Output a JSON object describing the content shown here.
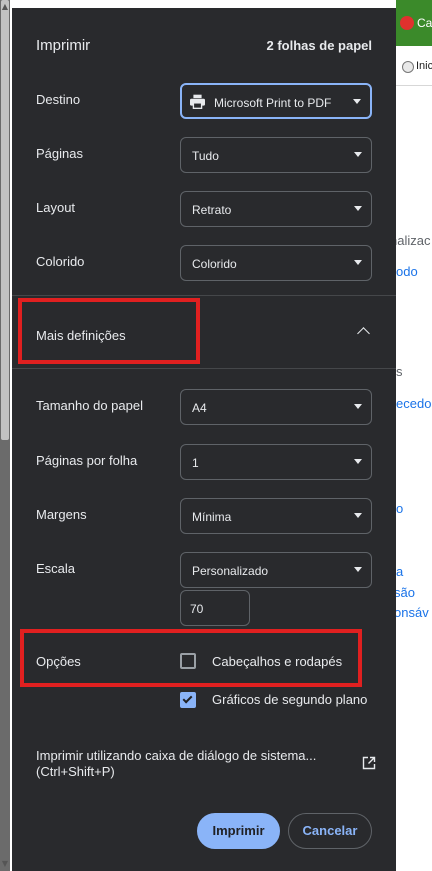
{
  "background": {
    "tab_text": "Ca",
    "toolbar_text": "Inicia",
    "fragments": [
      "nalizac",
      "odo",
      "s",
      "ecedo",
      "o",
      "a",
      "são",
      "onsáv"
    ]
  },
  "dialog": {
    "title": "Imprimir",
    "sheet_count": "2 folhas de papel",
    "destination": {
      "label": "Destino",
      "value": "Microsoft Print to PDF"
    },
    "pages": {
      "label": "Páginas",
      "value": "Tudo"
    },
    "layout": {
      "label": "Layout",
      "value": "Retrato"
    },
    "color": {
      "label": "Colorido",
      "value": "Colorido"
    },
    "more_settings": "Mais definições",
    "paper_size": {
      "label": "Tamanho do papel",
      "value": "A4"
    },
    "pages_per_sheet": {
      "label": "Páginas por folha",
      "value": "1"
    },
    "margins": {
      "label": "Margens",
      "value": "Mínima"
    },
    "scale": {
      "label": "Escala",
      "value": "Personalizado",
      "custom_value": "70"
    },
    "options": {
      "label": "Opções",
      "headers_footers": {
        "label": "Cabeçalhos e rodapés",
        "checked": false
      },
      "background_graphics": {
        "label": "Gráficos de segundo plano",
        "checked": true
      }
    },
    "system_dialog": {
      "line1": "Imprimir utilizando caixa de diálogo de sistema...",
      "line2": "(Ctrl+Shift+P)"
    },
    "print_button": "Imprimir",
    "cancel_button": "Cancelar"
  },
  "colors": {
    "dialog_bg": "#292a2d",
    "accent": "#8ab4f8",
    "annotation": "#e02020"
  }
}
